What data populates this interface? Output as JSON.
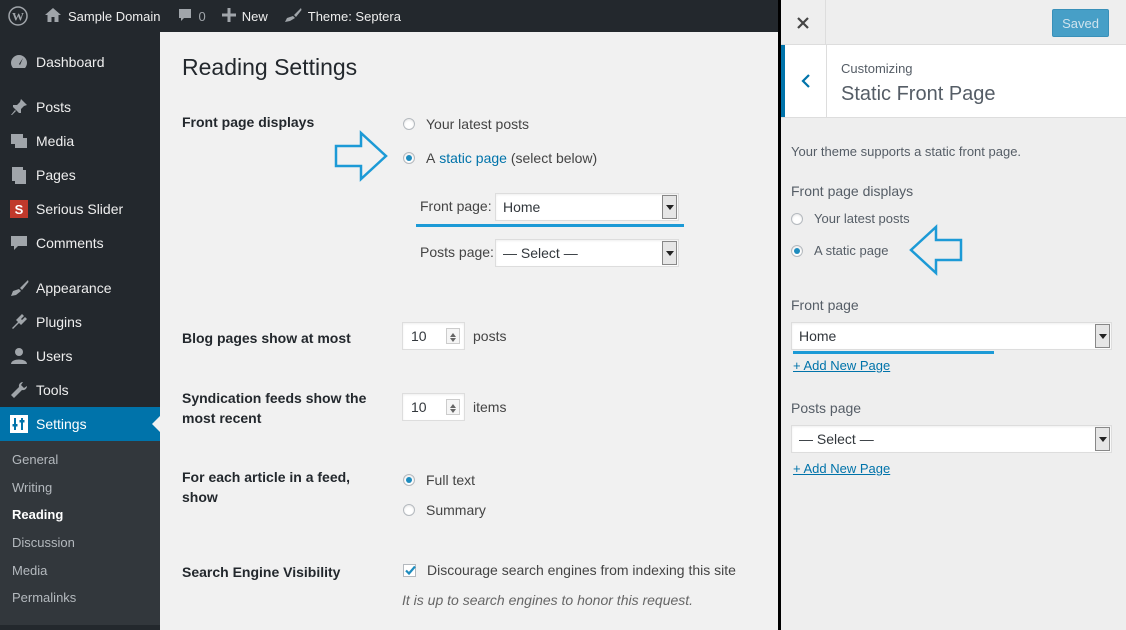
{
  "adminbar": {
    "site_name": "Sample Domain",
    "comments_count": "0",
    "new_label": "New",
    "theme_label": "Theme: Septera"
  },
  "sidebar": {
    "items": [
      {
        "label": "Dashboard",
        "icon": "dashboard-icon"
      },
      {
        "label": "Posts",
        "icon": "pin-icon"
      },
      {
        "label": "Media",
        "icon": "media-icon"
      },
      {
        "label": "Pages",
        "icon": "pages-icon"
      },
      {
        "label": "Serious Slider",
        "icon": "slider-icon"
      },
      {
        "label": "Comments",
        "icon": "comment-icon"
      },
      {
        "label": "Appearance",
        "icon": "brush-icon"
      },
      {
        "label": "Plugins",
        "icon": "plug-icon"
      },
      {
        "label": "Users",
        "icon": "user-icon"
      },
      {
        "label": "Tools",
        "icon": "wrench-icon"
      },
      {
        "label": "Settings",
        "icon": "settings-icon"
      }
    ],
    "submenu": [
      "General",
      "Writing",
      "Reading",
      "Discussion",
      "Media",
      "Permalinks"
    ]
  },
  "main": {
    "title": "Reading Settings",
    "front_page_displays": {
      "label": "Front page displays",
      "option_latest": "Your latest posts",
      "option_static_prefix": "A",
      "option_static_link": "static page",
      "option_static_suffix": "(select below)",
      "front_page_label": "Front page:",
      "front_page_value": "Home",
      "posts_page_label": "Posts page:",
      "posts_page_value": "— Select —"
    },
    "blog_pages": {
      "label": "Blog pages show at most",
      "value": "10",
      "unit": "posts"
    },
    "syndication": {
      "label": "Syndication feeds show the most recent",
      "value": "10",
      "unit": "items"
    },
    "feed_article": {
      "label": "For each article in a feed, show",
      "option_full": "Full text",
      "option_summary": "Summary"
    },
    "search_visibility": {
      "label": "Search Engine Visibility",
      "checkbox_label": "Discourage search engines from indexing this site",
      "description": "It is up to search engines to honor this request."
    }
  },
  "customizer": {
    "saved_label": "Saved",
    "breadcrumb": "Customizing",
    "section_title": "Static Front Page",
    "description": "Your theme supports a static front page.",
    "front_page_displays_label": "Front page displays",
    "option_latest": "Your latest posts",
    "option_static": "A static page",
    "front_page_label": "Front page",
    "front_page_value": "Home",
    "add_new_page_1": "+ Add New Page",
    "posts_page_label": "Posts page",
    "posts_page_value": "— Select —",
    "add_new_page_2": "+ Add New Page"
  },
  "colors": {
    "accent": "#0073aa",
    "highlight_arrow": "#1c9ad6",
    "sidebar_bg": "#23282d"
  }
}
